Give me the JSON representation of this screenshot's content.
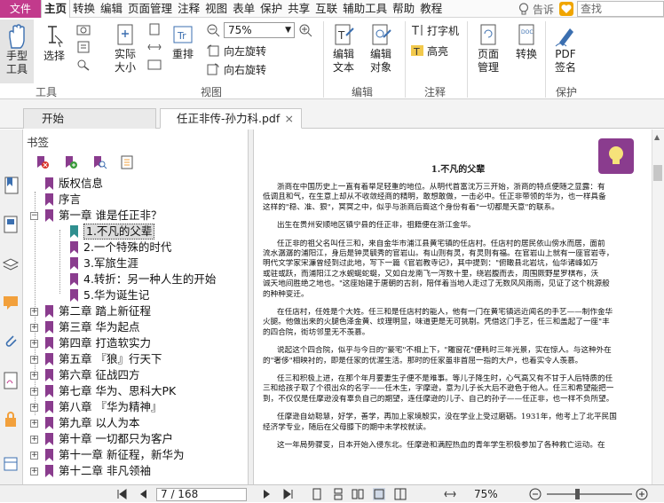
{
  "menu": {
    "file": "文件",
    "items": [
      "主页",
      "转换",
      "编辑",
      "页面管理",
      "注释",
      "视图",
      "表单",
      "保护",
      "共享",
      "互联",
      "辅助工具",
      "帮助",
      "教程"
    ],
    "tell": "告诉",
    "search_placeholder": "查找"
  },
  "ribbon": {
    "hand": [
      "手型",
      "工具"
    ],
    "select": "选择",
    "actual_size": [
      "实际",
      "大小"
    ],
    "reflow": "重排",
    "zoom_value": "75%",
    "rotate_left": "向左旋转",
    "rotate_right": "向右旋转",
    "edit_text": [
      "编辑",
      "文本"
    ],
    "edit_object": [
      "编辑",
      "对象"
    ],
    "typewriter": "打字机",
    "highlight": "高亮",
    "page_manage": [
      "页面",
      "管理"
    ],
    "convert": "转换",
    "pdf_sign": [
      "PDF",
      "签名"
    ],
    "groups": {
      "tools": "工具",
      "view": "视图",
      "edit": "编辑",
      "annotate": "注释",
      "protect": "保护"
    }
  },
  "tabs": {
    "start": "开始",
    "doc": "任正非传-孙力科.pdf"
  },
  "bookmarks": {
    "title": "书签",
    "items": [
      {
        "label": "版权信息",
        "level": 0,
        "expander": ""
      },
      {
        "label": "序言",
        "level": 0,
        "expander": ""
      },
      {
        "label": "第一章 谁是任正非？",
        "level": 0,
        "expander": "−"
      },
      {
        "label": "1.不凡的父辈",
        "level": 1,
        "expander": "",
        "selected": true
      },
      {
        "label": "2.一个特殊的时代",
        "level": 1,
        "expander": ""
      },
      {
        "label": "3.军旅生涯",
        "level": 1,
        "expander": ""
      },
      {
        "label": "4.转折：另一种人生的开始",
        "level": 1,
        "expander": ""
      },
      {
        "label": "5.华为诞生记",
        "level": 1,
        "expander": ""
      },
      {
        "label": "第二章 踏上新征程",
        "level": 0,
        "expander": "+"
      },
      {
        "label": "第三章 华为起点",
        "level": 0,
        "expander": "+"
      },
      {
        "label": "第四章 打造软实力",
        "level": 0,
        "expander": "+"
      },
      {
        "label": "第五章 『狼』行天下",
        "level": 0,
        "expander": "+"
      },
      {
        "label": "第六章 征战四方",
        "level": 0,
        "expander": "+"
      },
      {
        "label": "第七章 华为、思科大PK",
        "level": 0,
        "expander": "+"
      },
      {
        "label": "第八章 『华为精神』",
        "level": 0,
        "expander": "+"
      },
      {
        "label": "第九章 以人为本",
        "level": 0,
        "expander": "+"
      },
      {
        "label": "第十章 一切都只为客户",
        "level": 0,
        "expander": "+"
      },
      {
        "label": "第十一章 新征程，新华为",
        "level": 0,
        "expander": "+"
      },
      {
        "label": "第十二章 非凡领袖",
        "level": 0,
        "expander": "+"
      }
    ]
  },
  "document": {
    "chapter_title": "1.不凡的父辈",
    "paragraphs": [
      [
        "浙商在中国历史上一直有着举足轻重的地位。从明代首富沈万三开始，浙商的特点便随之显露：有",
        "低调且和气，在生意上却从不收敛经商的精明，敢想敢做，一击必中。任正非带领的华为，也一样具备",
        "这样的\"稳、准、狠\"，冥冥之中，似乎与浙商后裔这个身份有着\"一切都是天意\"的联系。"
      ],
      [
        "出生在贵州安顺地区镇宁县的任正非，祖籍便在浙江金华。"
      ],
      [
        "任正非的祖父名叫任三和，来自金华市浦江县黄宅镇的任店村。任店村的居民依山傍水而居，面前",
        "流水潺潺的浦阳江，身后是钟灵毓秀的官岩山。有山则有灵，有灵则有福。在官岩山上就有一座官岩寺，",
        "明代文学家宋濂曾经到过此地，写下一篇《官岩教寺记》，其中提到：\"俯瞰县北岩坑，仙华诸峰如万",
        "或驻或跃，而浦阳江之水蜿蜒蛇蜒，又如白龙南飞一泻数十里，绕岩腹而去，周围厥野星罗棋布，沃",
        "诚天地间胜绝之地也。\"这座始建于唐朝的古刹，陪伴着当地人走过了无数风风雨雨，见证了这个桃源般",
        "的种种变迁。"
      ],
      [
        "在任店村，任姓是个大姓。任三和是任店村的能人，他有一门在黄宅镇远近闻名的手艺——制作金华",
        "火腿。他做出来的火腿色泽金黄、纹理明显，味道更是无可挑剔。凭借这门手艺，任三和盖起了一座\"丰",
        "的四合院，街坊邻里无不羡慕。"
      ],
      [
        "说起这个四合院，似乎与今日的\"豪宅\"不相上下，\"雕窗花\"便耗时三年光景，实在惊人。与这种外在",
        "的\"奢侈\"相映衬的，即是任家的优渥生活。那时的任家虽非首屈一指的大户，也着实令人羡慕。"
      ],
      [
        "任三和积极上进，在那个年月要妻生子便不是难事。等儿子降生时，心气高又有不甘于人后特质的任",
        "三和给孩子取了个很出众的名字——任木生，字摩逊，意为儿子长大后不逊色于他人。任三和希望能把一",
        "到，不仅仅是任摩逊没有辜负自己的期望，连任摩逊的儿子、自己的孙子——任正非，也一样不负所望。"
      ],
      [
        "任摩逊自幼聪慧，好学，善学，再加上家境殷实，没在学业上受过磨砺。1931年，他考上了北平民国",
        "经济学专业，随后在父母膝下的期中未学校就读。"
      ],
      [
        "这一年局势骤变，日本开始入侵东北。任摩逊和满腔热血的青年学生积极参加了各种救亡运动。在"
      ]
    ]
  },
  "status": {
    "page": "7 / 168",
    "zoom": "75%"
  }
}
